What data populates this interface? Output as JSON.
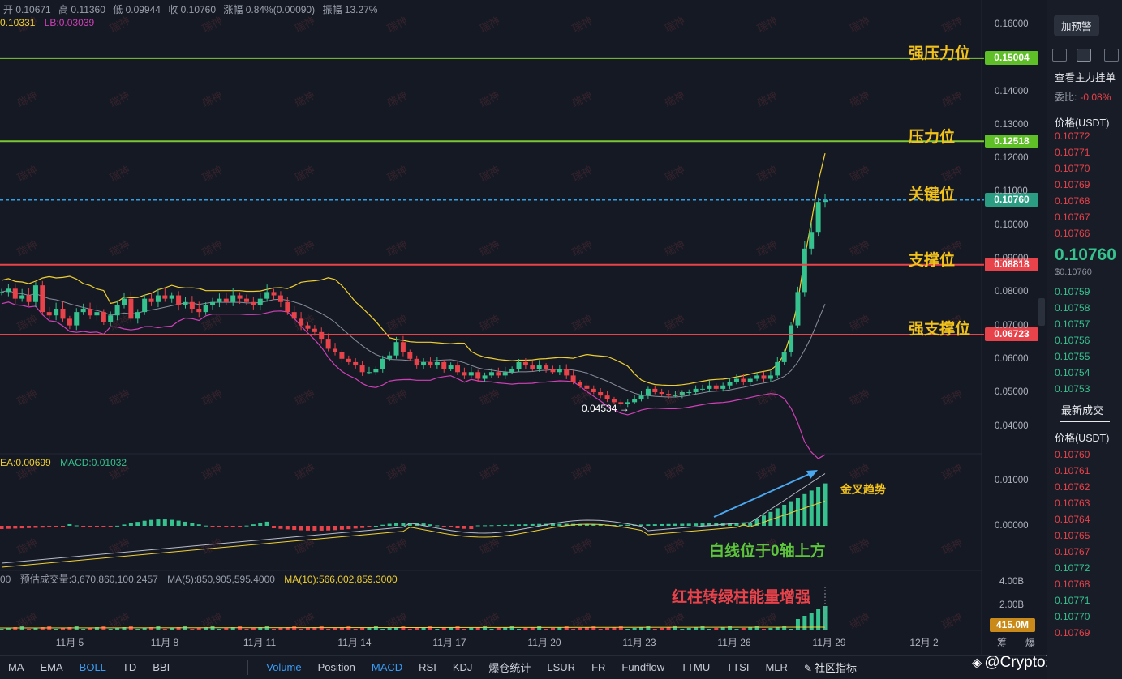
{
  "ohlc": {
    "open": "开 0.10671",
    "high": "高 0.11360",
    "low": "低 0.09944",
    "close": "收 0.10760",
    "change": "涨幅 0.84%(0.00090)",
    "amplitude": "振幅 13.27%"
  },
  "boll": {
    "ub": "0.10331",
    "lb": "LB:0.03039"
  },
  "macd": {
    "dea": "EA:0.00699",
    "macd": "MACD:0.01032"
  },
  "volume": {
    "prefix": "00",
    "est": "预估成交量:3,670,860,100.2457",
    "ma5": "MA(5):850,905,595.4000",
    "ma10": "MA(10):566,002,859.3000",
    "tag": "415.0M",
    "ticks": [
      "4.00B",
      "2.00B"
    ]
  },
  "levels": [
    {
      "name": "strong-resistance",
      "label": "强压力位",
      "price": 0.15004,
      "tag": "0.15004",
      "color": "#7cc832"
    },
    {
      "name": "resistance",
      "label": "压力位",
      "price": 0.12518,
      "tag": "0.12518",
      "color": "#7cc832"
    },
    {
      "name": "key",
      "label": "关键位",
      "price": 0.1076,
      "tag": "0.10760",
      "color": "#2ea2e6"
    },
    {
      "name": "support",
      "label": "支撑位",
      "price": 0.08818,
      "tag": "0.08818",
      "color": "#e8424a"
    },
    {
      "name": "strong-support",
      "label": "强支撑位",
      "price": 0.06723,
      "tag": "0.06723",
      "color": "#e8424a"
    }
  ],
  "annotations": {
    "low_marker": "0.04534 →",
    "golden_cross": "金叉趋势",
    "white_line": "白线位于0轴上方",
    "red_to_green": "红柱转绿柱能量增强"
  },
  "price_axis": [
    "0.16000",
    "0.14000",
    "0.13000",
    "0.12000",
    "0.11000",
    "0.10000",
    "0.09000",
    "0.08000",
    "0.07000",
    "0.06000",
    "0.05000",
    "0.04000"
  ],
  "macd_axis": [
    "0.01000",
    "0.00000"
  ],
  "date_axis": [
    "11月 5",
    "11月 8",
    "11月 11",
    "11月 14",
    "11月 17",
    "11月 20",
    "11月 23",
    "11月 26",
    "11月 29",
    "12月 2",
    "筹",
    "爆"
  ],
  "watermark": "瑞神",
  "toolbar": {
    "left": [
      "MA",
      "EMA",
      "BOLL",
      "TD",
      "BBI"
    ],
    "right": [
      "Volume",
      "Position",
      "MACD",
      "RSI",
      "KDJ",
      "爆仓统计",
      "LSUR",
      "FR",
      "Fundflow",
      "TTMU",
      "TTSI",
      "MLR"
    ],
    "community": "社区指标",
    "active": [
      "BOLL",
      "Volume",
      "MACD"
    ]
  },
  "brand": "@Crypto瑞神",
  "orderbook": {
    "alert_button": "加预警",
    "main_order": "查看主力挂单",
    "ratio_label": "委比:",
    "ratio_value": "-0.08%",
    "price_header": "价格(USDT)",
    "asks": [
      "0.10772",
      "0.10771",
      "0.10770",
      "0.10769",
      "0.10768",
      "0.10767",
      "0.10766"
    ],
    "last_price": "0.10760",
    "last_usd": "$0.10760",
    "bids": [
      "0.10759",
      "0.10758",
      "0.10757",
      "0.10756",
      "0.10755",
      "0.10754",
      "0.10753"
    ],
    "trades_title": "最新成交",
    "trades_header": "价格(USDT)",
    "trades": [
      {
        "p": "0.10760",
        "c": "red"
      },
      {
        "p": "0.10761",
        "c": "red"
      },
      {
        "p": "0.10762",
        "c": "red"
      },
      {
        "p": "0.10763",
        "c": "red"
      },
      {
        "p": "0.10764",
        "c": "red"
      },
      {
        "p": "0.10765",
        "c": "red"
      },
      {
        "p": "0.10767",
        "c": "red"
      },
      {
        "p": "0.10772",
        "c": "green"
      },
      {
        "p": "0.10768",
        "c": "red"
      },
      {
        "p": "0.10771",
        "c": "green"
      },
      {
        "p": "0.10770",
        "c": "green"
      },
      {
        "p": "0.10769",
        "c": "red"
      }
    ]
  },
  "colors": {
    "up": "#35c28e",
    "down": "#e8424a",
    "accent": "#3a9cf5",
    "level_text": "#f2c21b",
    "boll_upper": "#f0d030",
    "boll_lower": "#d040b8"
  },
  "chart_data": {
    "type": "candlestick",
    "close_series": [
      0.08,
      0.081,
      0.078,
      0.079,
      0.077,
      0.082,
      0.074,
      0.073,
      0.075,
      0.072,
      0.07,
      0.074,
      0.075,
      0.073,
      0.074,
      0.071,
      0.073,
      0.076,
      0.078,
      0.072,
      0.074,
      0.078,
      0.077,
      0.079,
      0.078,
      0.079,
      0.076,
      0.077,
      0.075,
      0.074,
      0.076,
      0.077,
      0.078,
      0.077,
      0.079,
      0.078,
      0.077,
      0.076,
      0.078,
      0.08,
      0.079,
      0.077,
      0.074,
      0.072,
      0.07,
      0.069,
      0.068,
      0.066,
      0.063,
      0.062,
      0.06,
      0.059,
      0.058,
      0.056,
      0.056,
      0.057,
      0.06,
      0.061,
      0.065,
      0.062,
      0.06,
      0.058,
      0.059,
      0.058,
      0.059,
      0.057,
      0.058,
      0.056,
      0.055,
      0.056,
      0.054,
      0.055,
      0.056,
      0.055,
      0.056,
      0.057,
      0.059,
      0.058,
      0.057,
      0.058,
      0.057,
      0.056,
      0.057,
      0.055,
      0.053,
      0.052,
      0.051,
      0.05,
      0.049,
      0.048,
      0.047,
      0.0465,
      0.047,
      0.048,
      0.049,
      0.051,
      0.05,
      0.0495,
      0.049,
      0.049,
      0.05,
      0.05,
      0.051,
      0.051,
      0.052,
      0.051,
      0.052,
      0.053,
      0.054,
      0.053,
      0.054,
      0.055,
      0.054,
      0.055,
      0.059,
      0.062,
      0.07,
      0.08,
      0.093,
      0.098,
      0.107,
      0.1076
    ],
    "low_marker_value": 0.04534,
    "boll_upper": 0.10331,
    "boll_lower": 0.03039,
    "macd_value": 0.01032,
    "dea_value": 0.00699,
    "x_labels": [
      "11月 5",
      "11月 8",
      "11月 11",
      "11月 14",
      "11月 17",
      "11月 20",
      "11月 23",
      "11月 26",
      "11月 29",
      "12月 2"
    ],
    "y_ticks": [
      0.16,
      0.14,
      0.13,
      0.12,
      0.11,
      0.1,
      0.09,
      0.08,
      0.07,
      0.06,
      0.05,
      0.04
    ]
  }
}
